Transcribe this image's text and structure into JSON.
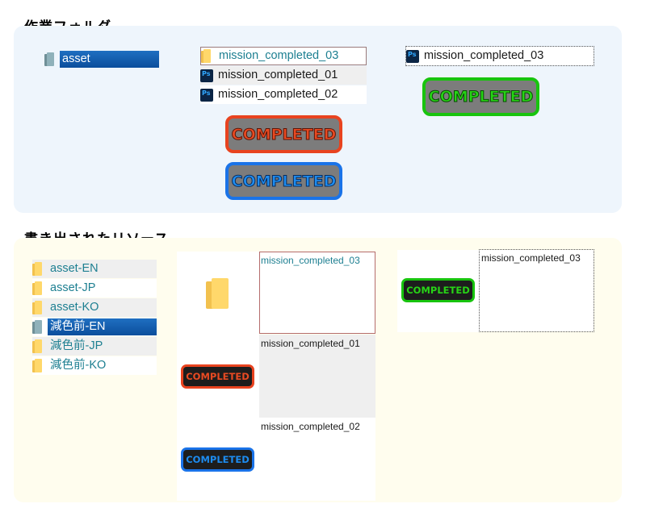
{
  "section1": {
    "title": "作業フォルダ",
    "left_item": "asset",
    "mid_list": [
      "mission_completed_03",
      "mission_completed_01",
      "mission_completed_02"
    ],
    "right_item": "mission_completed_03",
    "badge_text": "COMPLETED"
  },
  "section2": {
    "title": "書き出されたリソース",
    "tree": [
      "asset-EN",
      "asset-JP",
      "asset-KO",
      "減色前-EN",
      "減色前-JP",
      "減色前-KO"
    ],
    "thumbs": [
      "mission_completed_03",
      "mission_completed_01",
      "mission_completed_02"
    ],
    "right_thumb": "mission_completed_03",
    "badge_text": "COMPLETED"
  },
  "colors": {
    "panel_blue": "#eef5fc",
    "panel_yellow": "#fffdee",
    "selection": "#0b4e9c",
    "badge_red": "#e8431f",
    "badge_blue": "#1a73e8",
    "badge_green": "#18c40e"
  }
}
